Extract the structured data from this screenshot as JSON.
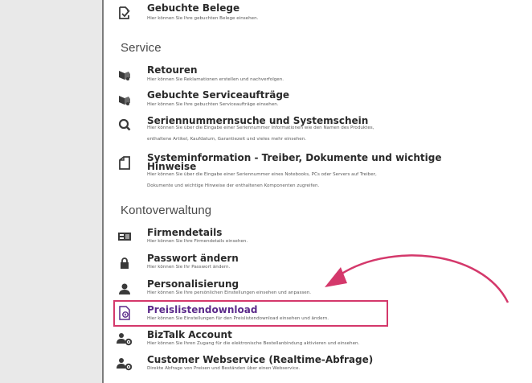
{
  "sections": [
    {
      "title": "Service"
    },
    {
      "title": "Kontoverwaltung"
    }
  ],
  "items": {
    "belege": {
      "title": "Gebuchte Belege",
      "desc": "Hier können Sie Ihre gebuchten Belege einsehen."
    },
    "retouren": {
      "title": "Retouren",
      "desc": "Hier können Sie Reklamationen erstellen und nachverfolgen."
    },
    "serviceauftraege": {
      "title": "Gebuchte Serviceaufträge",
      "desc": "Hier können Sie Ihre gebuchten Serviceaufträge einsehen."
    },
    "seriennummer": {
      "title": "Seriennummernsuche und Systemschein",
      "desc1": "Hier können Sie über die Eingabe einer Seriennummer Informationen wie den Namen des Produktes,",
      "desc2": "enthaltene Artikel, Kaufdatum, Garantiezeit und vieles mehr einsehen."
    },
    "systeminfo": {
      "title1": "Systeminformation - Treiber, Dokumente und wichtige",
      "title2": "Hinweise",
      "desc1": "Hier können Sie über die Eingabe einer Seriennummer eines Notebooks, PCs oder Servers auf Treiber,",
      "desc2": "Dokumente und wichtige Hinweise der enthaltenen Komponenten zugreifen."
    },
    "firmendetails": {
      "title": "Firmendetails",
      "desc": "Hier können Sie Ihre Firmendetails einsehen."
    },
    "passwort": {
      "title": "Passwort ändern",
      "desc": "Hier können Sie Ihr Passwort ändern."
    },
    "personalisierung": {
      "title": "Personalisierung",
      "desc": "Hier können Sie Ihre persönlichen Einstellungen einsehen und anpassen."
    },
    "preisliste": {
      "title": "Preislistendownload",
      "desc": "Hier können Sie Einstellungen für den Preislistendownload einsehen und ändern."
    },
    "biztalk": {
      "title": "BizTalk Account",
      "desc": "Hier können Sie Ihren Zugang für die elektronische Bestellanbindung aktivieren und einsehen."
    },
    "webservice": {
      "title": "Customer Webservice (Realtime-Abfrage)",
      "desc": "Direkte Abfrage von Preisen und Beständen über einen Webservice."
    }
  },
  "colors": {
    "highlight": "#d4386b",
    "icon": "#3a3a3a",
    "preisliste_title": "#5b2a8a"
  },
  "icons": {
    "belege": "document-check-icon",
    "retouren": "truck-icon",
    "serviceauftraege": "truck-icon",
    "seriennummer": "search-icon",
    "systeminfo": "documents-icon",
    "firmendetails": "id-card-icon",
    "passwort": "lock-icon",
    "personalisierung": "user-icon",
    "preisliste": "pricelist-document-icon",
    "biztalk": "user-gear-icon",
    "webservice": "user-gear-icon"
  }
}
